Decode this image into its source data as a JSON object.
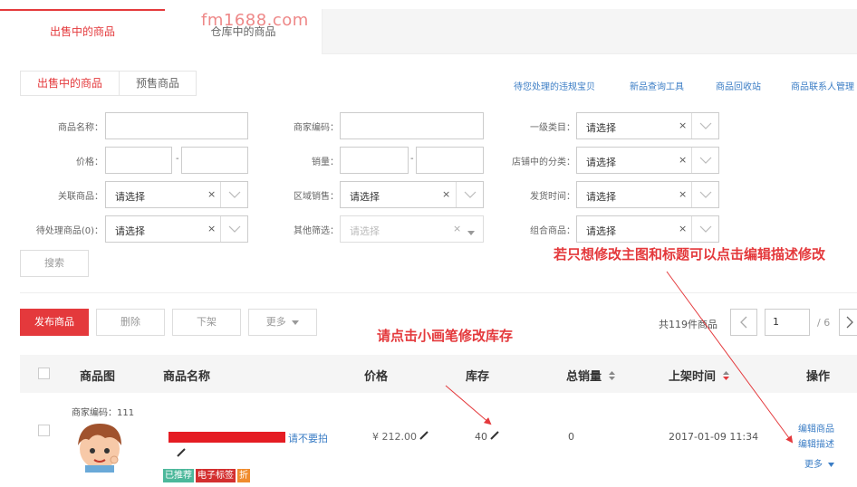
{
  "watermark": "fm1688.com",
  "top_tabs": [
    "出售中的商品",
    "仓库中的商品"
  ],
  "sub_tabs": [
    "出售中的商品",
    "预售商品"
  ],
  "top_links": [
    "待您处理的违规宝贝",
    "新品查询工具",
    "商品回收站",
    "商品联系人管理"
  ],
  "form": {
    "name_label": "商品名称：",
    "code_label": "商家编码：",
    "cat1_label": "一级类目：",
    "cat1_value": "请选择",
    "price_label": "价格：",
    "sales_label": "销量：",
    "shopcat_label": "店铺中的分类：",
    "shopcat_value": "请选择",
    "related_label": "关联商品：",
    "related_value": "请选择",
    "region_label": "区域销售：",
    "region_value": "请选择",
    "shiptime_label": "发货时间：",
    "shiptime_value": "请选择",
    "pending_label": "待处理商品(0)：",
    "pending_value": "请选择",
    "other_label": "其他筛选：",
    "other_value": "请选择",
    "combo_label": "组合商品：",
    "combo_value": "请选择",
    "range_sep": "-",
    "clear_symbol": "×",
    "search_button": "搜索"
  },
  "annotations": {
    "main_title_hint": "若只想修改主图和标题可以点击编辑描述修改",
    "stock_hint": "请点击小画笔修改库存"
  },
  "toolbar": {
    "publish": "发布商品",
    "delete": "删除",
    "unlist": "下架",
    "more": "更多",
    "total": "共119件商品",
    "page_input": "1",
    "page_total": "/ 6"
  },
  "table": {
    "headers": [
      "商品图",
      "商品名称",
      "价格",
      "库存",
      "总销量",
      "上架时间",
      "操作"
    ],
    "row": {
      "code": "商家编码：111",
      "name_suffix": "请不要拍",
      "price": "¥ 212.00",
      "stock": "40",
      "total_sales": "0",
      "listed_time": "2017-01-09 11:34",
      "tags": [
        "已推荐",
        "电子标签",
        "折"
      ],
      "actions": [
        "编辑商品",
        "编辑描述",
        "更多"
      ]
    }
  },
  "colors": {
    "accent": "#e4393c",
    "link": "#3b7dc5",
    "tag_green": "#4cb89b",
    "tag_red": "#d32f2f",
    "tag_orange": "#f08c2e"
  }
}
